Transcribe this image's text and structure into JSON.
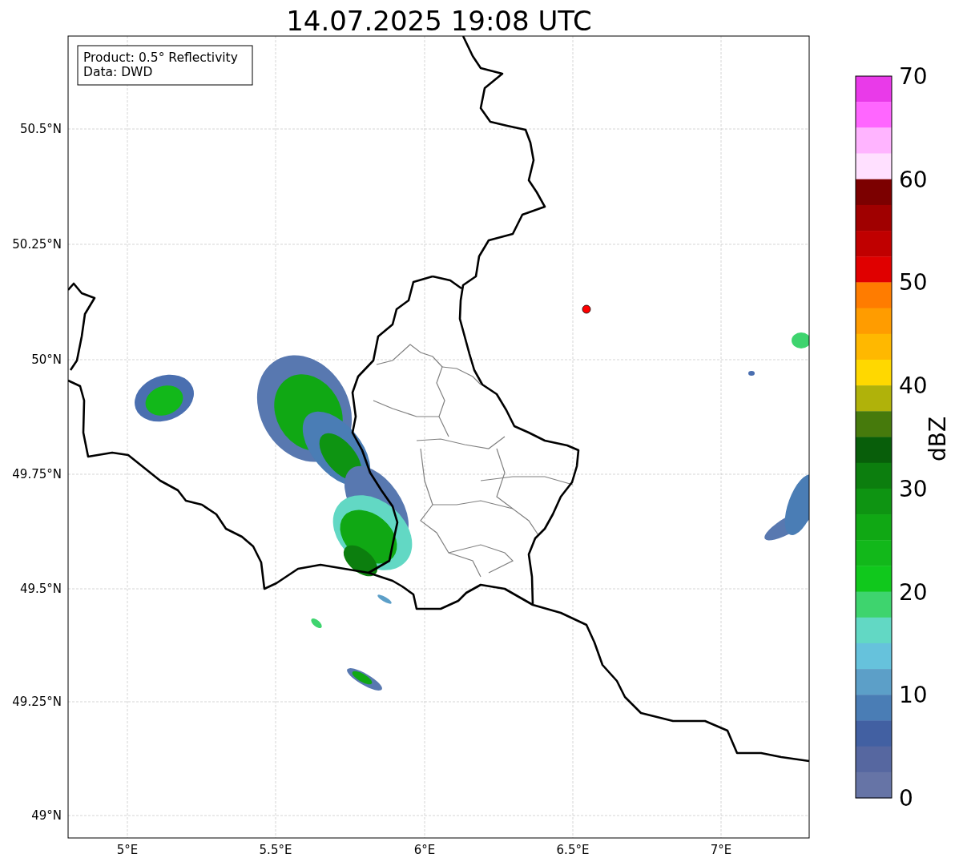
{
  "title": "14.07.2025 19:08 UTC",
  "legend": [
    "Product: 0.5° Reflectivity",
    "Data: DWD"
  ],
  "lat_labels": [
    "50.5°N",
    "50.25°N",
    "50°N",
    "49.75°N",
    "49.5°N",
    "49.25°N",
    "49°N"
  ],
  "lon_labels": [
    "5°E",
    "5.5°E",
    "6°E",
    "6.5°E",
    "7°E"
  ],
  "colorbar": {
    "label": "dBZ",
    "ticks": [
      "70",
      "60",
      "50",
      "40",
      "30",
      "20",
      "10",
      "0"
    ],
    "bins": [
      {
        "color": "#e93ae9"
      },
      {
        "color": "#ff66ff"
      },
      {
        "color": "#ffb4ff"
      },
      {
        "color": "#ffe0ff"
      },
      {
        "color": "#7c0000"
      },
      {
        "color": "#a00000"
      },
      {
        "color": "#c00000"
      },
      {
        "color": "#e00000"
      },
      {
        "color": "#ff7c00"
      },
      {
        "color": "#ff9c00"
      },
      {
        "color": "#ffb800"
      },
      {
        "color": "#ffd800"
      },
      {
        "color": "#b0b20a"
      },
      {
        "color": "#467a0c"
      },
      {
        "color": "#085e0a"
      },
      {
        "color": "#0c7e0e"
      },
      {
        "color": "#0e9412"
      },
      {
        "color": "#10a814"
      },
      {
        "color": "#12b81a"
      },
      {
        "color": "#10c81c"
      },
      {
        "color": "#3ed46e"
      },
      {
        "color": "#62d8c4"
      },
      {
        "color": "#66c2dc"
      },
      {
        "color": "#5c9fc8"
      },
      {
        "color": "#4a7db5"
      },
      {
        "color": "#4260a2"
      },
      {
        "color": "#5667a0"
      },
      {
        "color": "#6674a6"
      }
    ]
  }
}
